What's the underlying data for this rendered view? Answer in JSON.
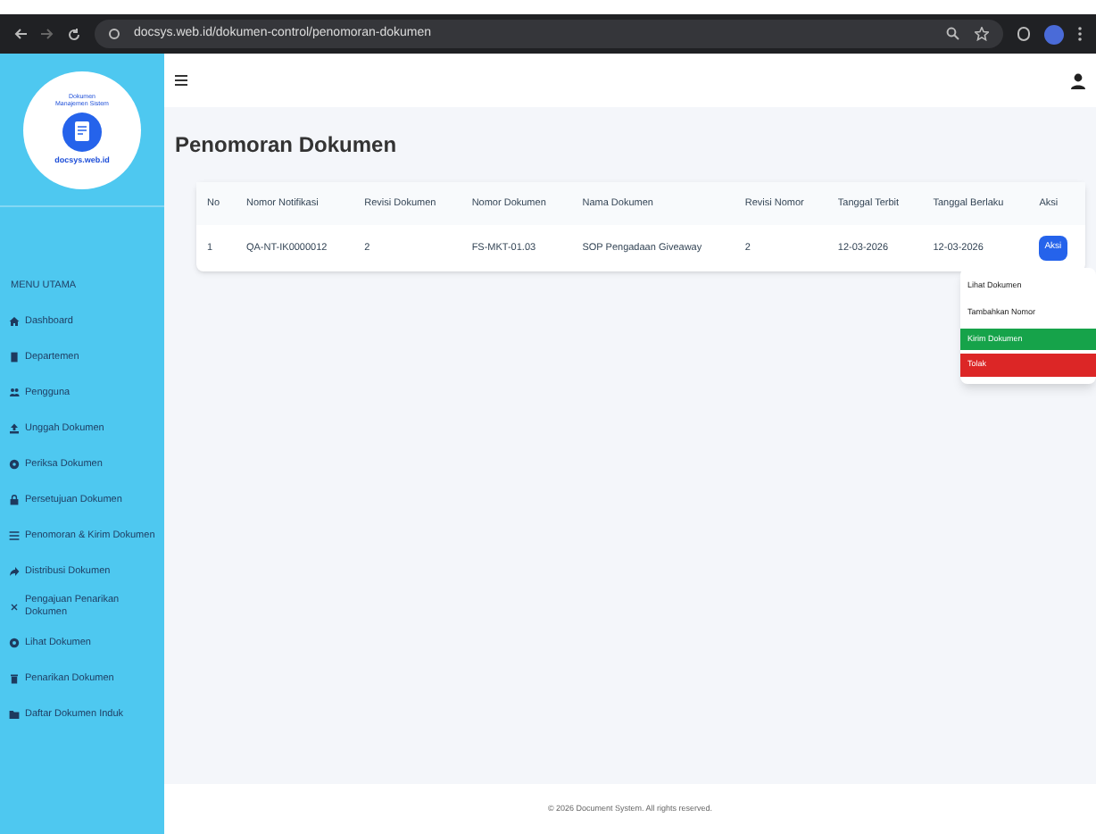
{
  "browser": {
    "url": "docsys.web.id/dokumen-control/penomoran-dokumen"
  },
  "sidebar": {
    "logo_top": "Dokumen Manajemen Sistem",
    "logo_bottom": "docsys.web.id",
    "section": "MENU UTAMA",
    "items": [
      {
        "label": "Dashboard"
      },
      {
        "label": "Departemen"
      },
      {
        "label": "Pengguna"
      },
      {
        "label": "Unggah Dokumen"
      },
      {
        "label": "Periksa Dokumen"
      },
      {
        "label": "Persetujuan Dokumen"
      },
      {
        "label": "Penomoran & Kirim Dokumen"
      },
      {
        "label": "Distribusi Dokumen"
      },
      {
        "label": "Pengajuan Penarikan Dokumen"
      },
      {
        "label": "Lihat Dokumen"
      },
      {
        "label": "Penarikan Dokumen"
      },
      {
        "label": "Daftar Dokumen Induk"
      }
    ]
  },
  "page": {
    "title": "Penomoran Dokumen"
  },
  "table": {
    "columns": [
      "No",
      "Nomor Notifikasi",
      "Revisi Dokumen",
      "Nomor Dokumen",
      "Nama Dokumen",
      "Revisi Nomor",
      "Tanggal Terbit",
      "Tanggal Berlaku",
      "Aksi"
    ],
    "rows": [
      {
        "cells": [
          "1",
          "QA-NT-IK0000012",
          "2",
          "FS-MKT-01.03",
          "SOP Pengadaan Giveaway",
          "2",
          "12-03-2026",
          "12-03-2026"
        ],
        "action": "Aksi"
      }
    ]
  },
  "menu": [
    {
      "label": "Lihat Dokumen",
      "kind": "plain"
    },
    {
      "label": "Tambahkan Nomor",
      "kind": "plain"
    },
    {
      "label": "Kirim Dokumen",
      "kind": "success"
    },
    {
      "label": "Tolak",
      "kind": "danger"
    }
  ],
  "footer": "© 2026 Document System. All rights reserved."
}
